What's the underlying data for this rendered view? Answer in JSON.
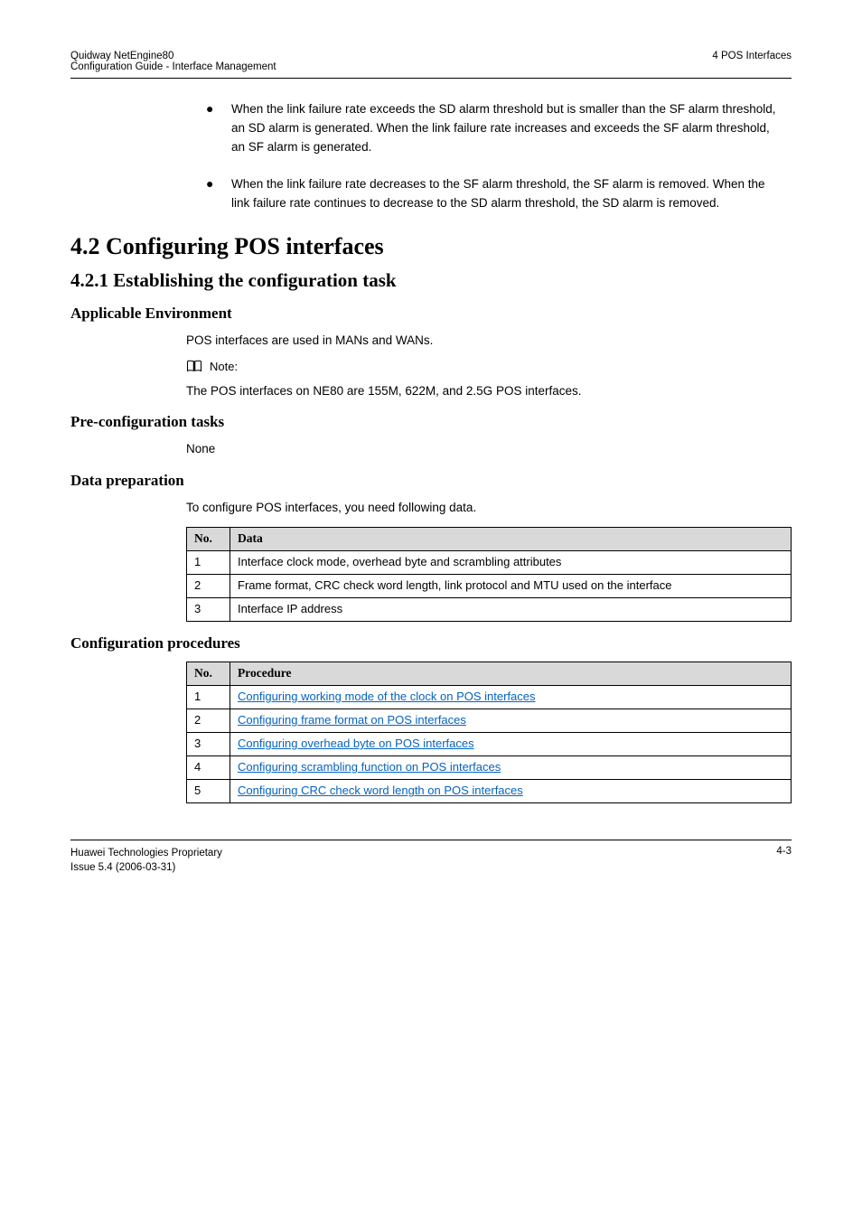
{
  "header": {
    "left_line1": "Quidway NetEngine80",
    "left_line2": "Configuration Guide - Interface Management",
    "right": "4 POS Interfaces"
  },
  "bullets": [
    "When the link failure rate exceeds the SD alarm threshold but is smaller than the SF alarm threshold, an SD alarm is generated. When the link failure rate increases and exceeds the SF alarm threshold, an SF alarm is generated.",
    "When the link failure rate decreases to the SF alarm threshold, the SF alarm is removed. When the link failure rate continues to decrease to the SD alarm threshold, the SD alarm is removed."
  ],
  "h1": "4.2 Configuring POS interfaces",
  "h2": "4.2.1 Establishing the configuration task",
  "sec_env": {
    "heading": "Applicable Environment",
    "body": "POS interfaces are used in MANs and WANs.",
    "note_label": "Note:",
    "note_body": "The POS interfaces on NE80 are 155M, 622M, and 2.5G POS interfaces."
  },
  "sec_pre": {
    "heading": "Pre-configuration tasks",
    "body": "None"
  },
  "sec_data": {
    "heading": "Data preparation",
    "intro": "To configure POS interfaces, you need following data.",
    "table": {
      "header_no": "No.",
      "header_data": "Data",
      "rows": [
        {
          "no": "1",
          "data": "Interface clock mode, overhead byte and scrambling attributes"
        },
        {
          "no": "2",
          "data": "Frame format, CRC check word length, link protocol and MTU used on the interface"
        },
        {
          "no": "3",
          "data": "Interface IP address"
        }
      ]
    }
  },
  "sec_proc": {
    "heading": "Configuration procedures",
    "table": {
      "header_no": "No.",
      "header_proc": "Procedure",
      "rows": [
        {
          "no": "1",
          "proc": "Configuring working mode of the clock on POS interfaces",
          "link": true
        },
        {
          "no": "2",
          "proc": "Configuring frame format on POS interfaces",
          "link": true
        },
        {
          "no": "3",
          "proc": "Configuring overhead byte on POS interfaces",
          "link": true
        },
        {
          "no": "4",
          "proc": "Configuring scrambling function on POS interfaces",
          "link": true
        },
        {
          "no": "5",
          "proc": "Configuring CRC check word length on POS interfaces",
          "link": true
        }
      ]
    }
  },
  "footer": {
    "left_line1": "Huawei Technologies Proprietary",
    "left_line2": "Issue 5.4 (2006-03-31)",
    "right": "4-3"
  }
}
